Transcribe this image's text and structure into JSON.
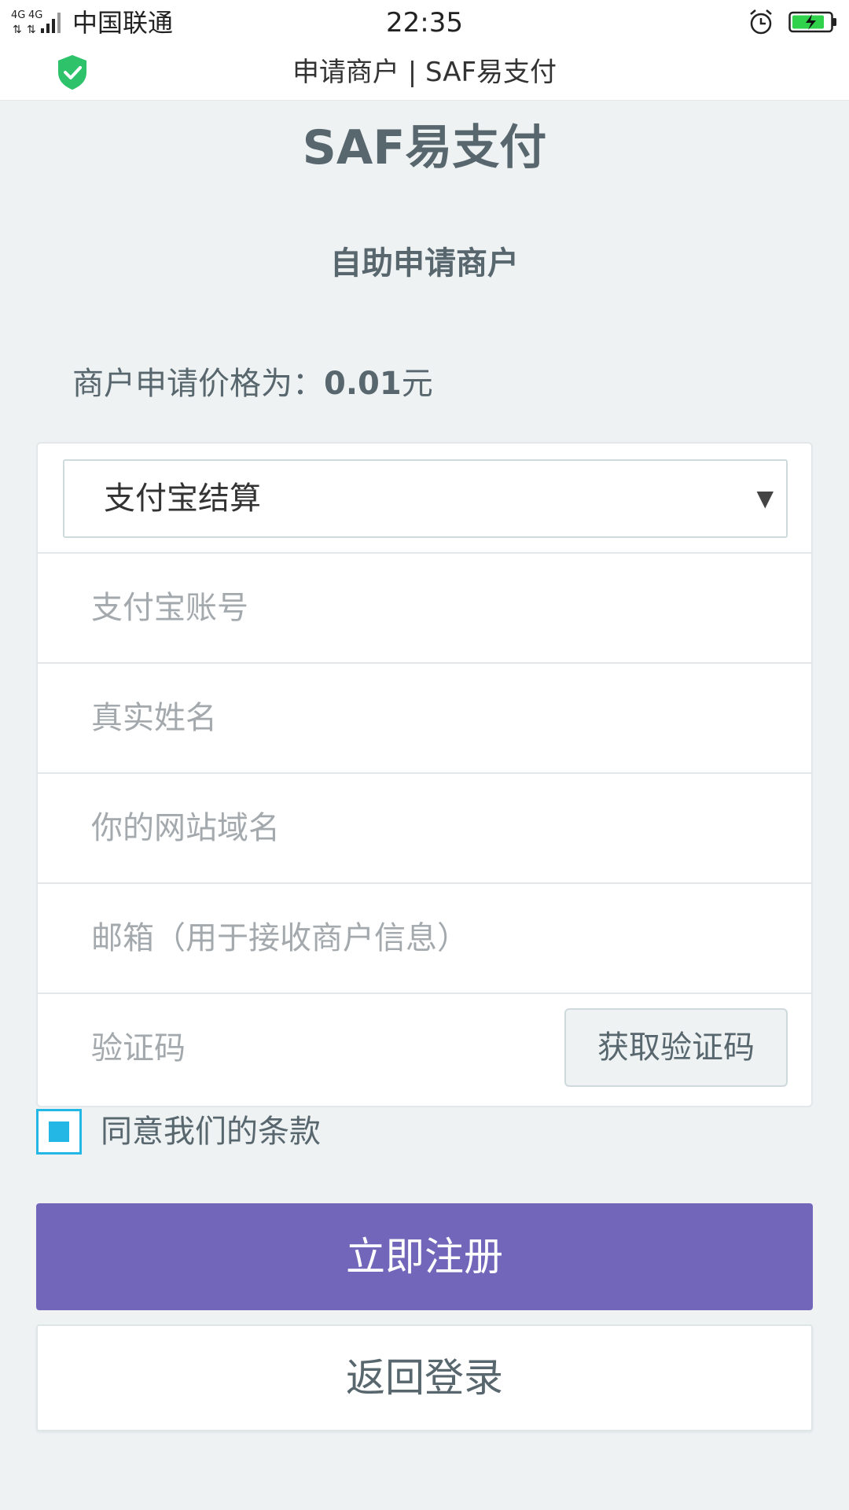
{
  "status_bar": {
    "network": "4G 4G",
    "carrier": "中国联通",
    "time": "22:35",
    "alarm_icon": "alarm-clock-icon",
    "battery_icon": "battery-charging-icon"
  },
  "browser": {
    "security_icon": "shield-check-icon",
    "page_title": "申请商户 | SAF易支付"
  },
  "page": {
    "brand": "SAF易支付",
    "subtitle": "自助申请商户",
    "price_label": "商户申请价格为：",
    "price_value": "0.01",
    "price_unit": "元"
  },
  "form": {
    "settlement_select": {
      "selected": "支付宝结算",
      "caret": "▼"
    },
    "alipay_account_placeholder": "支付宝账号",
    "real_name_placeholder": "真实姓名",
    "domain_placeholder": "你的网站域名",
    "email_placeholder": "邮箱（用于接收商户信息）",
    "code_placeholder": "验证码",
    "get_code_label": "获取验证码",
    "agree_label": "同意我们的条款",
    "agree_checked": true,
    "register_label": "立即注册",
    "back_label": "返回登录"
  },
  "colors": {
    "background": "#eef2f3",
    "text": "#58666e",
    "primary_button": "#7266ba",
    "checkbox": "#23b7e5",
    "shield": "#2ec36b",
    "battery": "#2fd24a"
  }
}
